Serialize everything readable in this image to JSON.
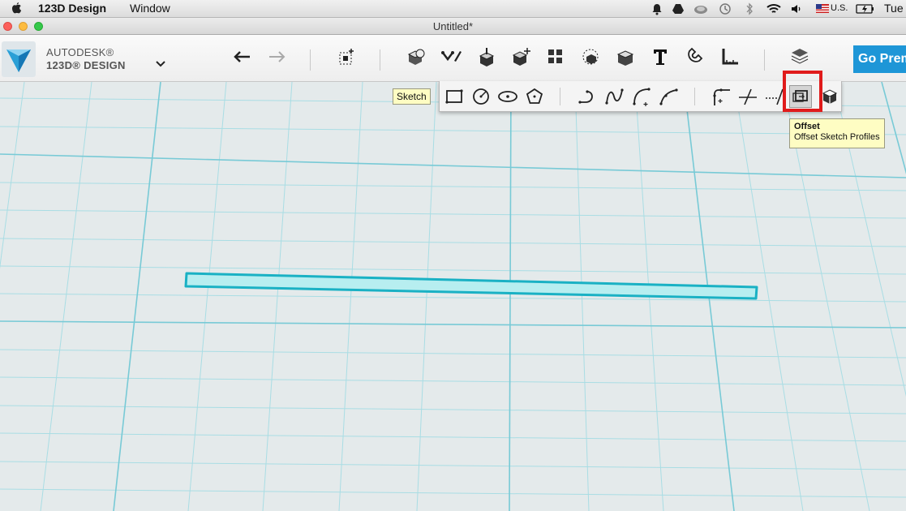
{
  "menubar": {
    "app_name": "123D Design",
    "menu_window": "Window",
    "locale": "U.S.",
    "day": "Tue",
    "tray_icons": [
      "bell-icon",
      "drive-icon",
      "cloud-icon",
      "time-machine-icon",
      "bluetooth-icon",
      "wifi-icon",
      "volume-icon",
      "flag-icon",
      "battery-icon"
    ]
  },
  "window": {
    "title": "Untitled*"
  },
  "toolbar": {
    "brand_line1": "AUTODESK®",
    "brand_line2": "123D® DESIGN",
    "go_premium_label": "Go Prem",
    "tools": [
      "undo",
      "redo",
      "transform",
      "primitives",
      "sketch",
      "construct",
      "modify",
      "pattern",
      "group",
      "combine",
      "text",
      "snap",
      "measure",
      "material"
    ]
  },
  "sketch_tooltip": "Sketch",
  "sketch_tools": [
    "sketch-rectangle",
    "sketch-circle",
    "sketch-ellipse",
    "sketch-polygon",
    "polyline",
    "spline",
    "two-point-arc",
    "three-point-arc",
    "fillet",
    "trim",
    "extend",
    "offset",
    "project"
  ],
  "offset_tooltip": {
    "title": "Offset",
    "description": "Offset Sketch Profiles"
  },
  "colors": {
    "accent": "#1e96d7",
    "grid_minor": "#a9dde4",
    "grid_major": "#78cad6",
    "sketch_outline": "#1ab1c4",
    "sketch_fill": "#b7eef0",
    "highlight": "#e01b1b",
    "tooltip_bg": "#fefdc3"
  }
}
